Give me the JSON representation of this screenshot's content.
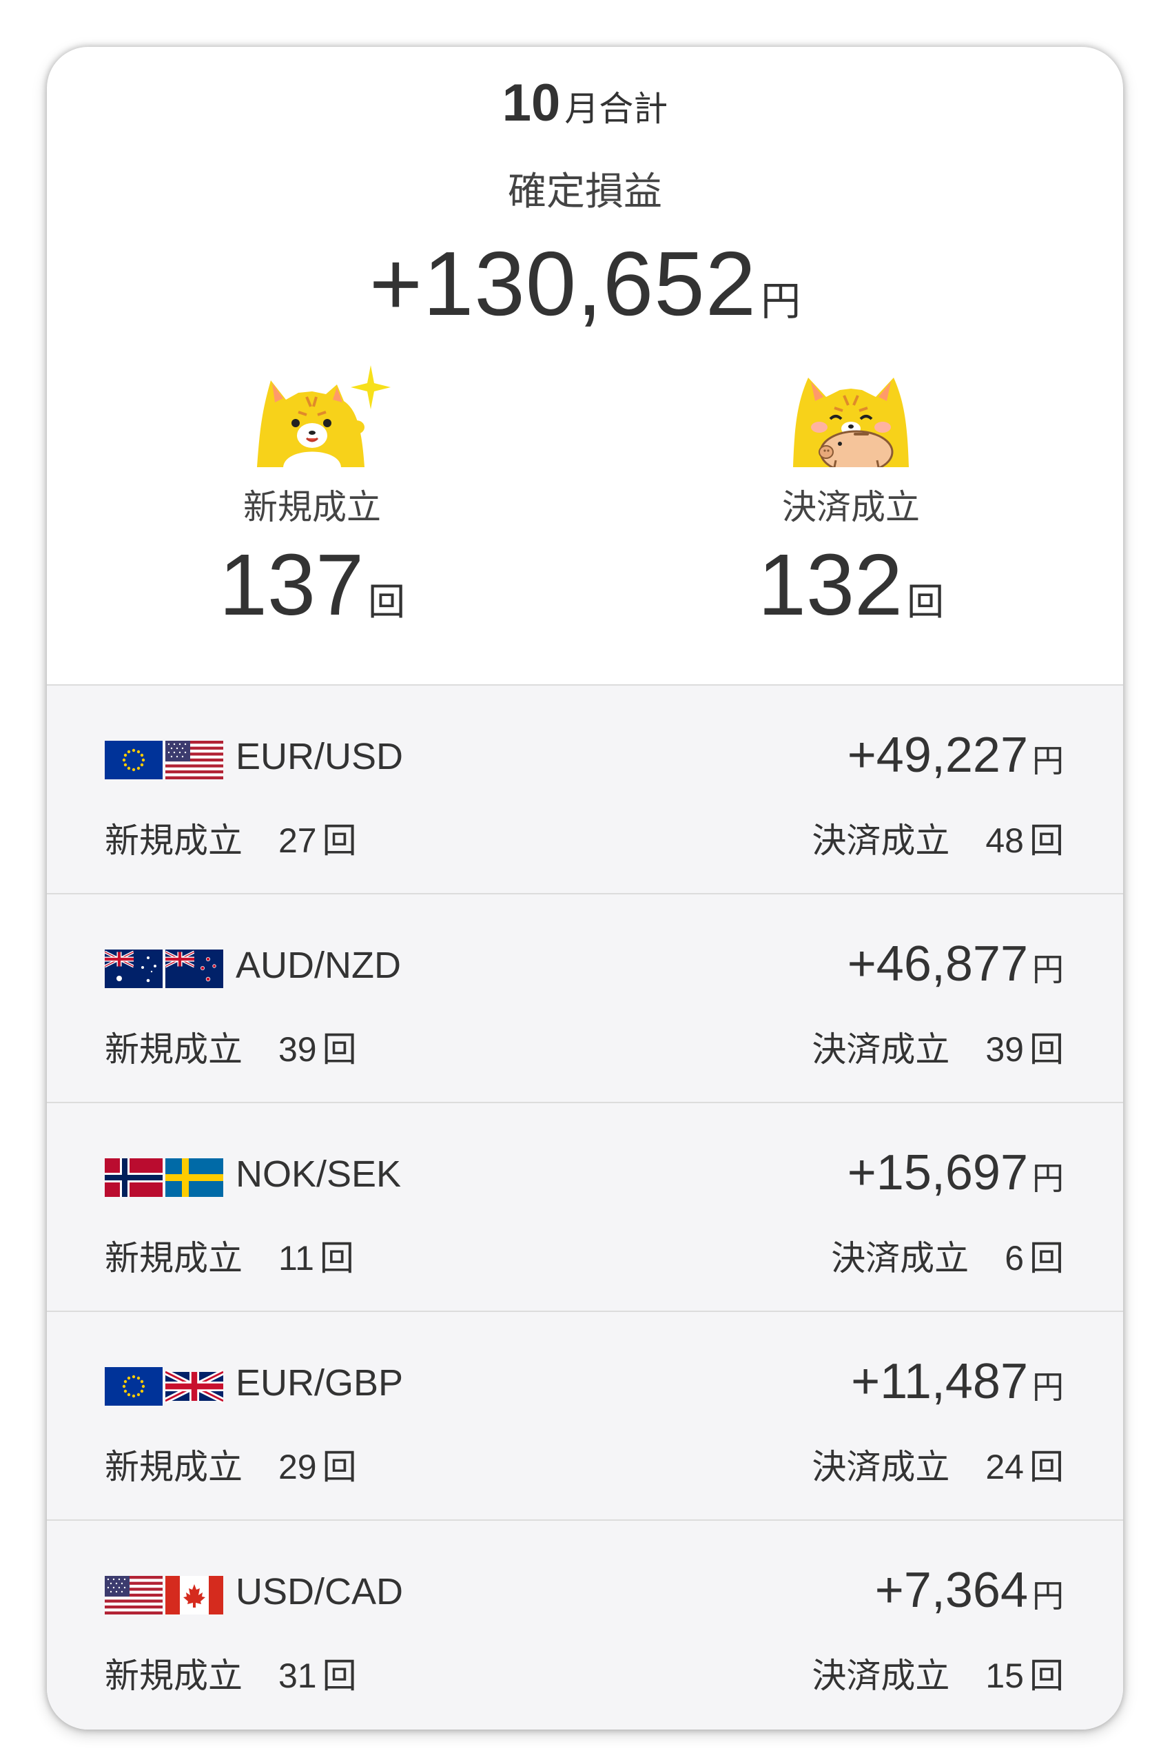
{
  "summary": {
    "month_number": "10",
    "month_label": "月合計",
    "pl_title": "確定損益",
    "pl_value": "+130,652",
    "pl_unit": "円",
    "new_label": "新規成立",
    "new_count": "137",
    "close_label": "決済成立",
    "close_count": "132",
    "count_unit": "回",
    "new_mascot_icon": "tiger-sparkle-icon",
    "close_mascot_icon": "tiger-piggybank-icon"
  },
  "pairs": [
    {
      "name": "EUR/USD",
      "pl": "+49,227",
      "unit": "円",
      "new_label": "新規成立",
      "new_count": "27",
      "close_label": "決済成立",
      "close_count": "48",
      "count_unit": "回",
      "flags": [
        "eu-flag-icon",
        "us-flag-icon"
      ]
    },
    {
      "name": "AUD/NZD",
      "pl": "+46,877",
      "unit": "円",
      "new_label": "新規成立",
      "new_count": "39",
      "close_label": "決済成立",
      "close_count": "39",
      "count_unit": "回",
      "flags": [
        "au-flag-icon",
        "nz-flag-icon"
      ]
    },
    {
      "name": "NOK/SEK",
      "pl": "+15,697",
      "unit": "円",
      "new_label": "新規成立",
      "new_count": "11",
      "close_label": "決済成立",
      "close_count": "6",
      "count_unit": "回",
      "flags": [
        "no-flag-icon",
        "se-flag-icon"
      ]
    },
    {
      "name": "EUR/GBP",
      "pl": "+11,487",
      "unit": "円",
      "new_label": "新規成立",
      "new_count": "29",
      "close_label": "決済成立",
      "close_count": "24",
      "count_unit": "回",
      "flags": [
        "eu-flag-icon",
        "gb-flag-icon"
      ]
    },
    {
      "name": "USD/CAD",
      "pl": "+7,364",
      "unit": "円",
      "new_label": "新規成立",
      "new_count": "31",
      "close_label": "決済成立",
      "close_count": "15",
      "count_unit": "回",
      "flags": [
        "us-flag-icon",
        "ca-flag-icon"
      ]
    }
  ],
  "colors": {
    "mascot_yellow": "#f7d21a",
    "row_background": "#f5f5f7",
    "divider": "#dcdcdc"
  }
}
